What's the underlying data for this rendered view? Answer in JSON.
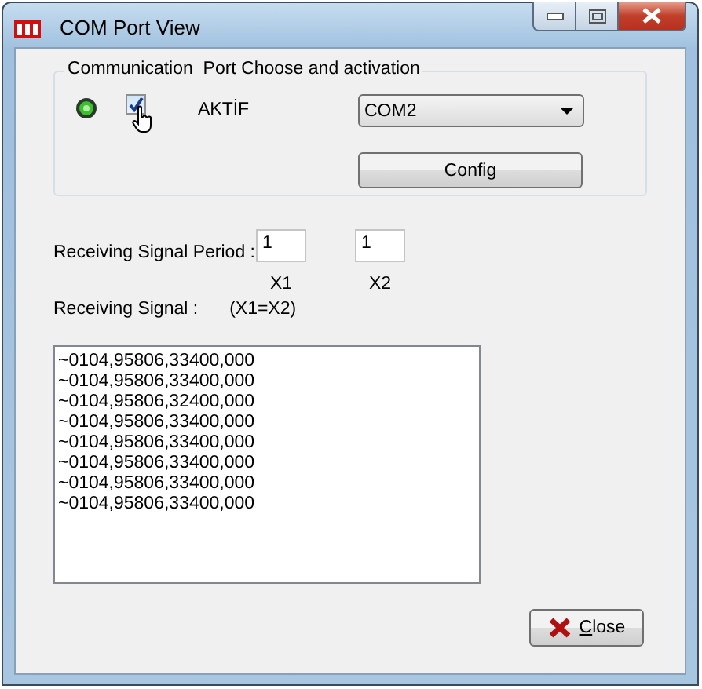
{
  "window": {
    "title": "COM Port View"
  },
  "port_group": {
    "title": "Communication  Port Choose and activation",
    "led_on": true,
    "active_checked": true,
    "active_label": "AKTİF",
    "port": "COM2",
    "config_button": "Config"
  },
  "period": {
    "label": "Receiving Signal Period :",
    "fields": [
      {
        "value": "1",
        "caption": "X1"
      },
      {
        "value": "1",
        "caption": "X2"
      }
    ]
  },
  "signal": {
    "label": "Receiving Signal :",
    "note": "(X1=X2)",
    "lines": [
      "~0104,95806,33400,000",
      "~0104,95806,33400,000",
      "~0104,95806,32400,000",
      "~0104,95806,33400,000",
      "~0104,95806,33400,000",
      "~0104,95806,33400,000",
      "~0104,95806,33400,000",
      "~0104,95806,33400,000"
    ]
  },
  "close_button": "Close"
}
